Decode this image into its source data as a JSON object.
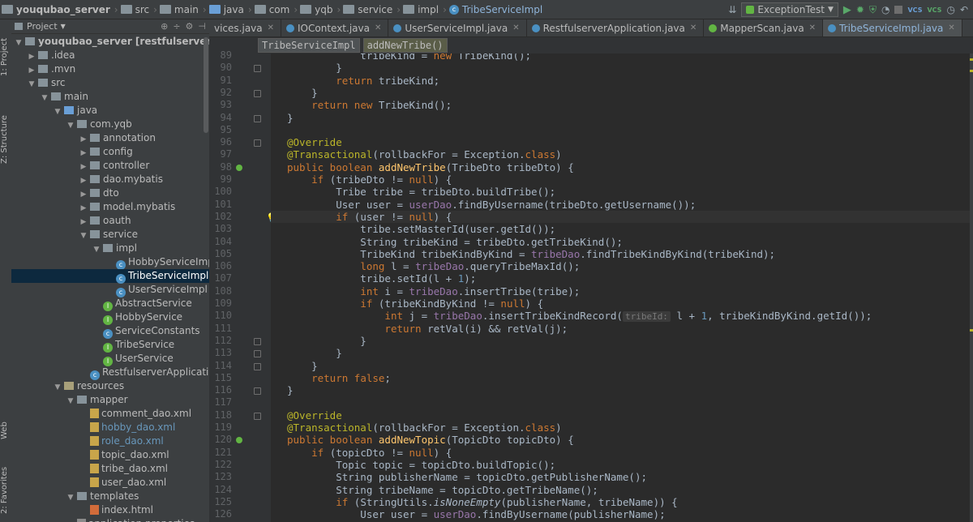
{
  "navbar": {
    "crumbs": [
      "youqubao_server",
      "src",
      "main",
      "java",
      "com",
      "yqb",
      "service",
      "impl",
      "TribeServiceImpl"
    ],
    "run_config": "ExceptionTest"
  },
  "left_strip": {
    "project_label": "1: Project",
    "structure_label": "Z: Structure",
    "web_label": "Web",
    "favorites_label": "2: Favorites"
  },
  "project_panel": {
    "title": "Project",
    "tree": [
      {
        "label": "youqubao_server [restfulserver]",
        "depth": 0,
        "kind": "module",
        "arrow": "down"
      },
      {
        "label": ".idea",
        "depth": 1,
        "kind": "folder",
        "arrow": "right"
      },
      {
        "label": ".mvn",
        "depth": 1,
        "kind": "folder",
        "arrow": "right"
      },
      {
        "label": "src",
        "depth": 1,
        "kind": "folder",
        "arrow": "down"
      },
      {
        "label": "main",
        "depth": 2,
        "kind": "folder",
        "arrow": "down"
      },
      {
        "label": "java",
        "depth": 3,
        "kind": "folder-blue",
        "arrow": "down"
      },
      {
        "label": "com.yqb",
        "depth": 4,
        "kind": "folder",
        "arrow": "down"
      },
      {
        "label": "annotation",
        "depth": 5,
        "kind": "folder",
        "arrow": "right"
      },
      {
        "label": "config",
        "depth": 5,
        "kind": "folder",
        "arrow": "right"
      },
      {
        "label": "controller",
        "depth": 5,
        "kind": "folder",
        "arrow": "right"
      },
      {
        "label": "dao.mybatis",
        "depth": 5,
        "kind": "folder",
        "arrow": "right"
      },
      {
        "label": "dto",
        "depth": 5,
        "kind": "folder",
        "arrow": "right"
      },
      {
        "label": "model.mybatis",
        "depth": 5,
        "kind": "folder",
        "arrow": "right"
      },
      {
        "label": "oauth",
        "depth": 5,
        "kind": "folder",
        "arrow": "right"
      },
      {
        "label": "service",
        "depth": 5,
        "kind": "folder",
        "arrow": "down"
      },
      {
        "label": "impl",
        "depth": 6,
        "kind": "folder",
        "arrow": "down"
      },
      {
        "label": "HobbyServiceImpl",
        "depth": 7,
        "kind": "class",
        "arrow": ""
      },
      {
        "label": "TribeServiceImpl",
        "depth": 7,
        "kind": "class",
        "arrow": "",
        "selected": true
      },
      {
        "label": "UserServiceImpl",
        "depth": 7,
        "kind": "class",
        "arrow": ""
      },
      {
        "label": "AbstractService",
        "depth": 6,
        "kind": "interface",
        "arrow": ""
      },
      {
        "label": "HobbyService",
        "depth": 6,
        "kind": "interface",
        "arrow": ""
      },
      {
        "label": "ServiceConstants",
        "depth": 6,
        "kind": "class",
        "arrow": ""
      },
      {
        "label": "TribeService",
        "depth": 6,
        "kind": "interface",
        "arrow": ""
      },
      {
        "label": "UserService",
        "depth": 6,
        "kind": "interface",
        "arrow": ""
      },
      {
        "label": "RestfulserverApplication",
        "depth": 5,
        "kind": "class",
        "arrow": ""
      },
      {
        "label": "resources",
        "depth": 3,
        "kind": "folder-res",
        "arrow": "down"
      },
      {
        "label": "mapper",
        "depth": 4,
        "kind": "folder",
        "arrow": "down"
      },
      {
        "label": "comment_dao.xml",
        "depth": 5,
        "kind": "xml",
        "arrow": ""
      },
      {
        "label": "hobby_dao.xml",
        "depth": 5,
        "kind": "xml",
        "arrow": "",
        "modified": true
      },
      {
        "label": "role_dao.xml",
        "depth": 5,
        "kind": "xml",
        "arrow": "",
        "modified": true
      },
      {
        "label": "topic_dao.xml",
        "depth": 5,
        "kind": "xml",
        "arrow": ""
      },
      {
        "label": "tribe_dao.xml",
        "depth": 5,
        "kind": "xml",
        "arrow": ""
      },
      {
        "label": "user_dao.xml",
        "depth": 5,
        "kind": "xml",
        "arrow": ""
      },
      {
        "label": "templates",
        "depth": 4,
        "kind": "folder",
        "arrow": "down"
      },
      {
        "label": "index.html",
        "depth": 5,
        "kind": "html",
        "arrow": ""
      },
      {
        "label": "application.properties",
        "depth": 4,
        "kind": "file",
        "arrow": ""
      }
    ]
  },
  "tabs": [
    {
      "label": "vices.java",
      "icon": "class"
    },
    {
      "label": "IOContext.java",
      "icon": "class"
    },
    {
      "label": "UserServiceImpl.java",
      "icon": "class"
    },
    {
      "label": "RestfulserverApplication.java",
      "icon": "class"
    },
    {
      "label": "MapperScan.java",
      "icon": "annotation"
    },
    {
      "label": "TribeServiceImpl.java",
      "icon": "class",
      "active": true
    }
  ],
  "editor_breadcrumb": {
    "class": "TribeServiceImpl",
    "method": "addNewTribe()"
  },
  "code": {
    "first_line": 89,
    "current_line": 102,
    "lines": [
      [
        [
          "            tribeKind = ",
          ""
        ],
        [
          "new",
          "kw"
        ],
        [
          " TribeKind();",
          ""
        ]
      ],
      [
        [
          "        }",
          ""
        ]
      ],
      [
        [
          "        ",
          ""
        ],
        [
          "return",
          "kw"
        ],
        [
          " tribeKind;",
          ""
        ]
      ],
      [
        [
          "    }",
          ""
        ]
      ],
      [
        [
          "    ",
          ""
        ],
        [
          "return new",
          "kw"
        ],
        [
          " TribeKind();",
          ""
        ]
      ],
      [
        [
          "}",
          ""
        ]
      ],
      [
        [
          "",
          ""
        ]
      ],
      [
        [
          "@Override",
          "ann"
        ]
      ],
      [
        [
          "@Transactional",
          "ann"
        ],
        [
          "(rollbackFor = Exception.",
          ""
        ],
        [
          "class",
          "kw"
        ],
        [
          ")",
          ""
        ]
      ],
      [
        [
          "public boolean",
          "kw"
        ],
        [
          " ",
          ""
        ],
        [
          "addNewTribe",
          "fn"
        ],
        [
          "(TribeDto tribeDto) {",
          ""
        ]
      ],
      [
        [
          "    ",
          ""
        ],
        [
          "if",
          "kw"
        ],
        [
          " (tribeDto != ",
          ""
        ],
        [
          "null",
          "kw"
        ],
        [
          ") {",
          ""
        ]
      ],
      [
        [
          "        Tribe tribe = tribeDto.buildTribe();",
          ""
        ]
      ],
      [
        [
          "        User user = ",
          ""
        ],
        [
          "userDao",
          "fld"
        ],
        [
          ".findByUsername(tribeDto.getUsername());",
          ""
        ]
      ],
      [
        [
          "        ",
          ""
        ],
        [
          "if",
          "kw"
        ],
        [
          " (user != ",
          ""
        ],
        [
          "null",
          "kw"
        ],
        [
          ") {",
          ""
        ]
      ],
      [
        [
          "            tribe.setMasterId(user.getId());",
          ""
        ]
      ],
      [
        [
          "            String tribeKind = tribeDto.getTribeKind();",
          ""
        ]
      ],
      [
        [
          "            TribeKind tribeKindByKind = ",
          ""
        ],
        [
          "tribeDao",
          "fld"
        ],
        [
          ".findTribeKindByKind(tribeKind);",
          ""
        ]
      ],
      [
        [
          "            ",
          ""
        ],
        [
          "long",
          "kw"
        ],
        [
          " l = ",
          ""
        ],
        [
          "tribeDao",
          "fld"
        ],
        [
          ".queryTribeMaxId();",
          ""
        ]
      ],
      [
        [
          "            tribe.setId(l + ",
          ""
        ],
        [
          "1",
          "num"
        ],
        [
          ");",
          ""
        ]
      ],
      [
        [
          "            ",
          ""
        ],
        [
          "int",
          "kw"
        ],
        [
          " i = ",
          ""
        ],
        [
          "tribeDao",
          "fld"
        ],
        [
          ".insertTribe(tribe);",
          ""
        ]
      ],
      [
        [
          "            ",
          ""
        ],
        [
          "if",
          "kw"
        ],
        [
          " (tribeKindByKind != ",
          ""
        ],
        [
          "null",
          "kw"
        ],
        [
          ") {",
          ""
        ]
      ],
      [
        [
          "                ",
          ""
        ],
        [
          "int",
          "kw"
        ],
        [
          " j = ",
          ""
        ],
        [
          "tribeDao",
          "fld"
        ],
        [
          ".insertTribeKindRecord(",
          ""
        ],
        [
          "tribeId:",
          "hint"
        ],
        [
          " l + ",
          ""
        ],
        [
          "1",
          "num"
        ],
        [
          ", tribeKindByKind.getId());",
          ""
        ]
      ],
      [
        [
          "                ",
          ""
        ],
        [
          "return",
          "kw"
        ],
        [
          " retVal(i) && retVal(j);",
          ""
        ]
      ],
      [
        [
          "            }",
          ""
        ]
      ],
      [
        [
          "        }",
          ""
        ]
      ],
      [
        [
          "    }",
          ""
        ]
      ],
      [
        [
          "    ",
          ""
        ],
        [
          "return false",
          "kw"
        ],
        [
          ";",
          ""
        ]
      ],
      [
        [
          "}",
          ""
        ]
      ],
      [
        [
          "",
          ""
        ]
      ],
      [
        [
          "@Override",
          "ann"
        ]
      ],
      [
        [
          "@Transactional",
          "ann"
        ],
        [
          "(rollbackFor = Exception.",
          ""
        ],
        [
          "class",
          "kw"
        ],
        [
          ")",
          ""
        ]
      ],
      [
        [
          "public boolean",
          "kw"
        ],
        [
          " ",
          ""
        ],
        [
          "addNewTopic",
          "fn"
        ],
        [
          "(TopicDto topicDto) {",
          ""
        ]
      ],
      [
        [
          "    ",
          ""
        ],
        [
          "if",
          "kw"
        ],
        [
          " (topicDto != ",
          ""
        ],
        [
          "null",
          "kw"
        ],
        [
          ") {",
          ""
        ]
      ],
      [
        [
          "        Topic topic = topicDto.buildTopic();",
          ""
        ]
      ],
      [
        [
          "        String publisherName = topicDto.getPublisherName();",
          ""
        ]
      ],
      [
        [
          "        String tribeName = topicDto.getTribeName();",
          ""
        ]
      ],
      [
        [
          "        ",
          ""
        ],
        [
          "if",
          "kw"
        ],
        [
          " (StringUtils.",
          ""
        ],
        [
          "isNoneEmpty",
          "it"
        ],
        [
          "(publisherName, tribeName)) {",
          ""
        ]
      ],
      [
        [
          "            User user = ",
          ""
        ],
        [
          "userDao",
          "fld"
        ],
        [
          ".findByUsername(publisherName);",
          ""
        ]
      ]
    ]
  },
  "colors": {
    "background": "#2b2b2b",
    "panel": "#3c3f41",
    "keyword": "#cc7832",
    "annotation": "#bbb529",
    "method": "#ffc66d",
    "field": "#9876aa",
    "number": "#6897bb",
    "text": "#a9b7c6"
  }
}
